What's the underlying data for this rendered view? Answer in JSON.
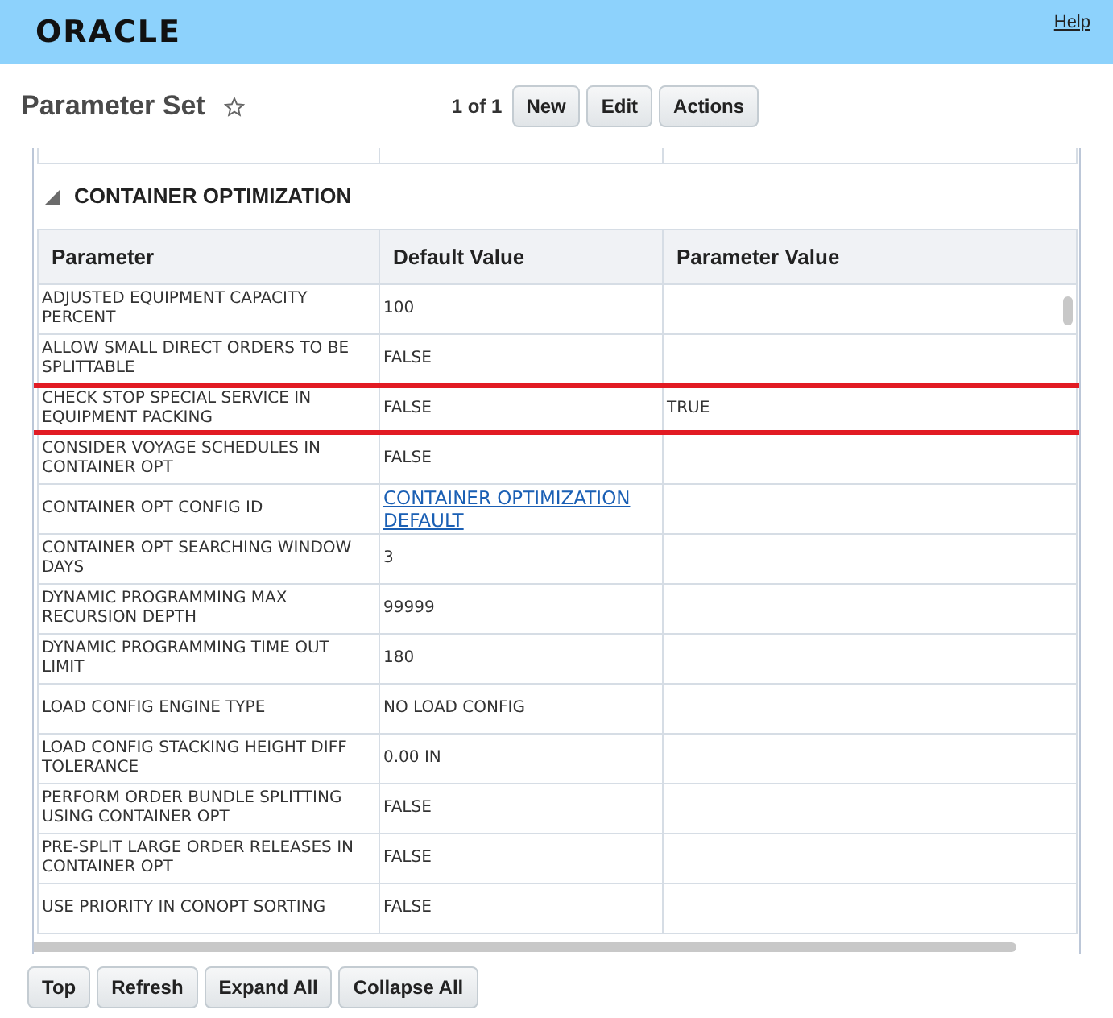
{
  "header": {
    "logo": "ORACLE",
    "help_link": "Help"
  },
  "page": {
    "title": "Parameter Set",
    "favorite": false,
    "pager": "1 of 1",
    "buttons": [
      "New",
      "Edit",
      "Actions"
    ]
  },
  "section": {
    "title": "CONTAINER OPTIMIZATION",
    "expanded": true
  },
  "table": {
    "columns": [
      "Parameter",
      "Default Value",
      "Parameter Value"
    ],
    "rows": [
      {
        "parameter": "ADJUSTED EQUIPMENT CAPACITY PERCENT",
        "default_value": "100",
        "default_is_link": false,
        "parameter_value": "",
        "highlighted": false
      },
      {
        "parameter": "ALLOW SMALL DIRECT ORDERS TO BE SPLITTABLE",
        "default_value": "FALSE",
        "default_is_link": false,
        "parameter_value": "",
        "highlighted": false
      },
      {
        "parameter": "CHECK STOP SPECIAL SERVICE IN EQUIPMENT PACKING",
        "default_value": "FALSE",
        "default_is_link": false,
        "parameter_value": "TRUE",
        "highlighted": true
      },
      {
        "parameter": "CONSIDER VOYAGE SCHEDULES IN CONTAINER OPT",
        "default_value": "FALSE",
        "default_is_link": false,
        "parameter_value": "",
        "highlighted": false
      },
      {
        "parameter": "CONTAINER OPT CONFIG ID",
        "default_value": "CONTAINER OPTIMIZATION DEFAULT",
        "default_is_link": true,
        "parameter_value": "",
        "highlighted": false
      },
      {
        "parameter": "CONTAINER OPT SEARCHING WINDOW DAYS",
        "default_value": "3",
        "default_is_link": false,
        "parameter_value": "",
        "highlighted": false
      },
      {
        "parameter": "DYNAMIC PROGRAMMING MAX RECURSION DEPTH",
        "default_value": "99999",
        "default_is_link": false,
        "parameter_value": "",
        "highlighted": false
      },
      {
        "parameter": "DYNAMIC PROGRAMMING TIME OUT LIMIT",
        "default_value": "180",
        "default_is_link": false,
        "parameter_value": "",
        "highlighted": false
      },
      {
        "parameter": "LOAD CONFIG ENGINE TYPE",
        "default_value": "NO LOAD CONFIG",
        "default_is_link": false,
        "parameter_value": "",
        "highlighted": false
      },
      {
        "parameter": "LOAD CONFIG STACKING HEIGHT DIFF TOLERANCE",
        "default_value": "0.00 IN",
        "default_is_link": false,
        "parameter_value": "",
        "highlighted": false
      },
      {
        "parameter": "PERFORM ORDER BUNDLE SPLITTING USING CONTAINER OPT",
        "default_value": "FALSE",
        "default_is_link": false,
        "parameter_value": "",
        "highlighted": false
      },
      {
        "parameter": "PRE-SPLIT LARGE ORDER RELEASES IN CONTAINER OPT",
        "default_value": "FALSE",
        "default_is_link": false,
        "parameter_value": "",
        "highlighted": false
      },
      {
        "parameter": "USE PRIORITY IN CONOPT SORTING",
        "default_value": "FALSE",
        "default_is_link": false,
        "parameter_value": "",
        "highlighted": false
      }
    ]
  },
  "footer_buttons": [
    "Top",
    "Refresh",
    "Expand All",
    "Collapse All"
  ]
}
